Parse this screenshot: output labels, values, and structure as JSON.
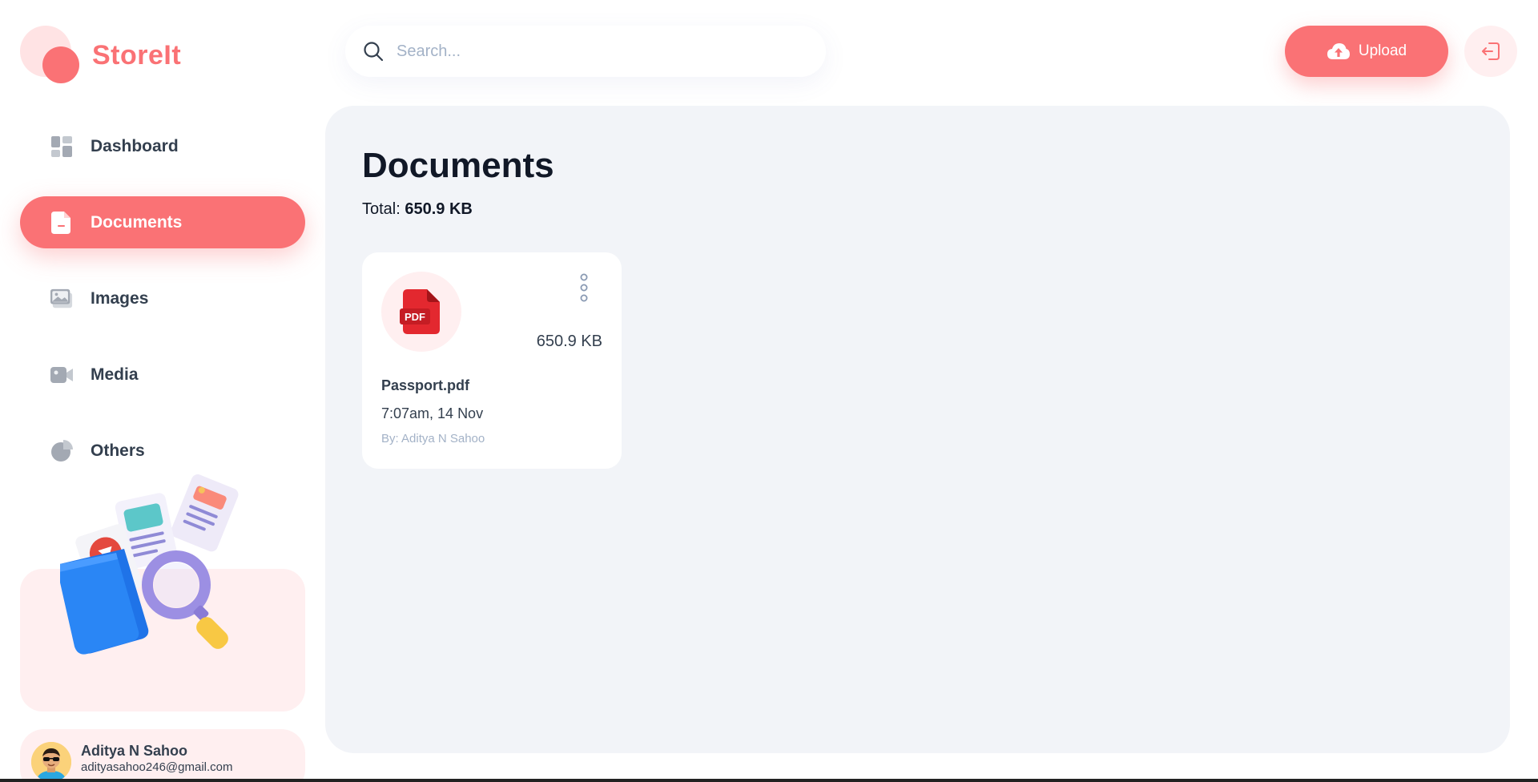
{
  "app": {
    "name": "StoreIt"
  },
  "sidebar": {
    "items": [
      {
        "label": "Dashboard",
        "icon": "dashboard-icon",
        "active": false
      },
      {
        "label": "Documents",
        "icon": "documents-icon",
        "active": true
      },
      {
        "label": "Images",
        "icon": "images-icon",
        "active": false
      },
      {
        "label": "Media",
        "icon": "media-icon",
        "active": false
      },
      {
        "label": "Others",
        "icon": "others-icon",
        "active": false
      }
    ]
  },
  "user": {
    "name": "Aditya N Sahoo",
    "email": "adityasahoo246@gmail.com"
  },
  "header": {
    "search_placeholder": "Search...",
    "upload_label": "Upload"
  },
  "page": {
    "title": "Documents",
    "total_label": "Total:",
    "total_value": "650.9 KB"
  },
  "files": [
    {
      "type_label": "PDF",
      "size": "650.9 KB",
      "name": "Passport.pdf",
      "date": "7:07am, 14 Nov",
      "owner": "By: Aditya N Sahoo"
    }
  ],
  "colors": {
    "brand": "#fa7275",
    "brand_light": "#ffeff0",
    "main_bg": "#f2f4f8",
    "text": "#333f4e",
    "muted": "#a3b2c7"
  }
}
